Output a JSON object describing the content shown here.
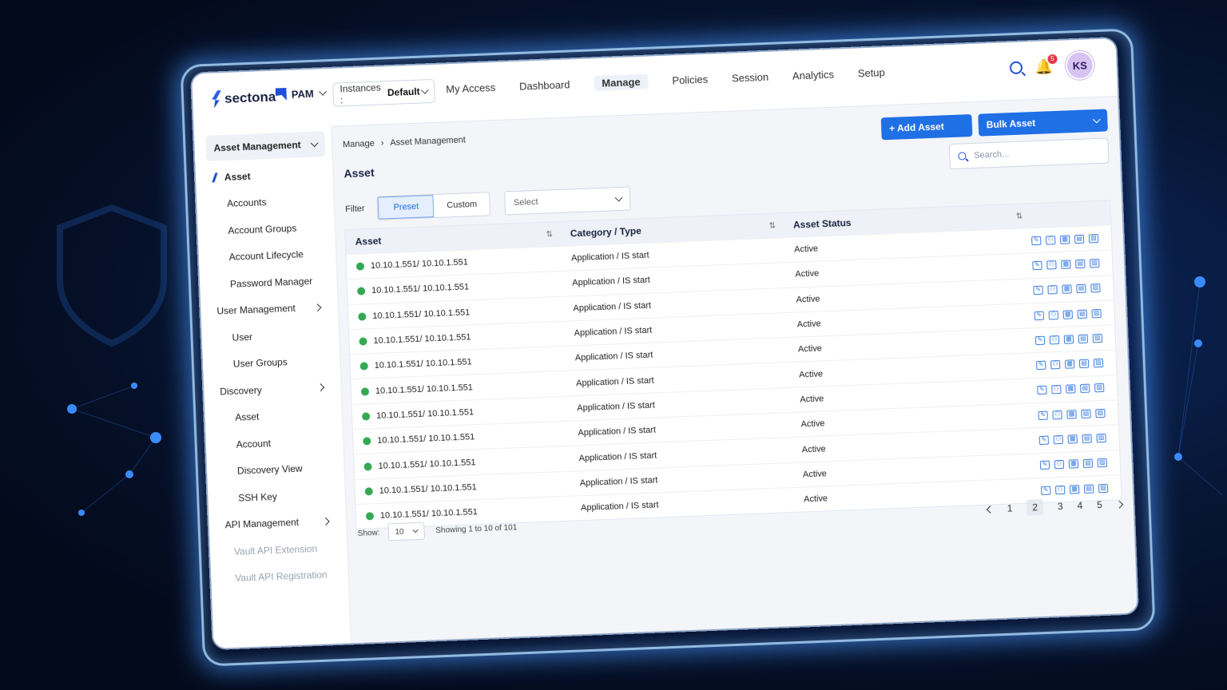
{
  "brand": {
    "name": "sectona",
    "product": "PAM"
  },
  "instances": {
    "label": "Instances : ",
    "value": "Default"
  },
  "nav": [
    "My Access",
    "Dashboard",
    "Manage",
    "Policies",
    "Session",
    "Analytics",
    "Setup"
  ],
  "nav_active": "Manage",
  "notifications": {
    "count": "5"
  },
  "user": {
    "initials": "KS"
  },
  "sidebar": {
    "asset_management": "Asset Management",
    "asset": "Asset",
    "accounts": "Accounts",
    "account_groups": "Account Groups",
    "account_lifecycle": "Account Lifecycle",
    "password_manager": "Password Manager",
    "user_management": "User Management",
    "user": "User",
    "user_groups": "User Groups",
    "discovery": "Discovery",
    "disc_asset": "Asset",
    "disc_account": "Account",
    "discovery_view": "Discovery View",
    "ssh_key": "SSH Key",
    "api_management": "API Management",
    "vault_api_extension": "Vault API Extension",
    "vault_api_registration": "Vault API Registration"
  },
  "breadcrumb": {
    "root": "Manage",
    "sep": "›",
    "current": "Asset Management"
  },
  "page_title": "Asset",
  "actions": {
    "add": "+ Add Asset",
    "bulk": "Bulk Asset"
  },
  "search": {
    "placeholder": "Search..."
  },
  "filter": {
    "label": "Filter",
    "preset": "Preset",
    "custom": "Custom",
    "select": "Select"
  },
  "table": {
    "headers": {
      "asset": "Asset",
      "category": "Category / Type",
      "status": "Asset Status"
    },
    "sort_glyph": "⇅",
    "rows": [
      {
        "asset": "10.10.1.551/ 10.10.1.551",
        "category": "Application / IS start",
        "status": "Active"
      },
      {
        "asset": "10.10.1.551/ 10.10.1.551",
        "category": "Application / IS start",
        "status": "Active"
      },
      {
        "asset": "10.10.1.551/ 10.10.1.551",
        "category": "Application / IS start",
        "status": "Active"
      },
      {
        "asset": "10.10.1.551/ 10.10.1.551",
        "category": "Application / IS start",
        "status": "Active"
      },
      {
        "asset": "10.10.1.551/ 10.10.1.551",
        "category": "Application / IS start",
        "status": "Active"
      },
      {
        "asset": "10.10.1.551/ 10.10.1.551",
        "category": "Application / IS start",
        "status": "Active"
      },
      {
        "asset": "10.10.1.551/ 10.10.1.551",
        "category": "Application / IS start",
        "status": "Active"
      },
      {
        "asset": "10.10.1.551/ 10.10.1.551",
        "category": "Application / IS start",
        "status": "Active"
      },
      {
        "asset": "10.10.1.551/ 10.10.1.551",
        "category": "Application / IS start",
        "status": "Active"
      },
      {
        "asset": "10.10.1.551/ 10.10.1.551",
        "category": "Application / IS start",
        "status": "Active"
      },
      {
        "asset": "10.10.1.551/ 10.10.1.551",
        "category": "Application / IS start",
        "status": "Active"
      }
    ]
  },
  "row_actions": [
    "edit-icon",
    "user-icon",
    "grid-icon",
    "calendar-icon",
    "image-icon"
  ],
  "pagination": {
    "show_label": "Show:",
    "page_size": "10",
    "summary": "Showing 1 to 10 of 101",
    "pages": [
      "1",
      "2",
      "3",
      "4",
      "5"
    ],
    "current": "2"
  },
  "colors": {
    "accent": "#1f6fe5",
    "status_active": "#34a853"
  }
}
